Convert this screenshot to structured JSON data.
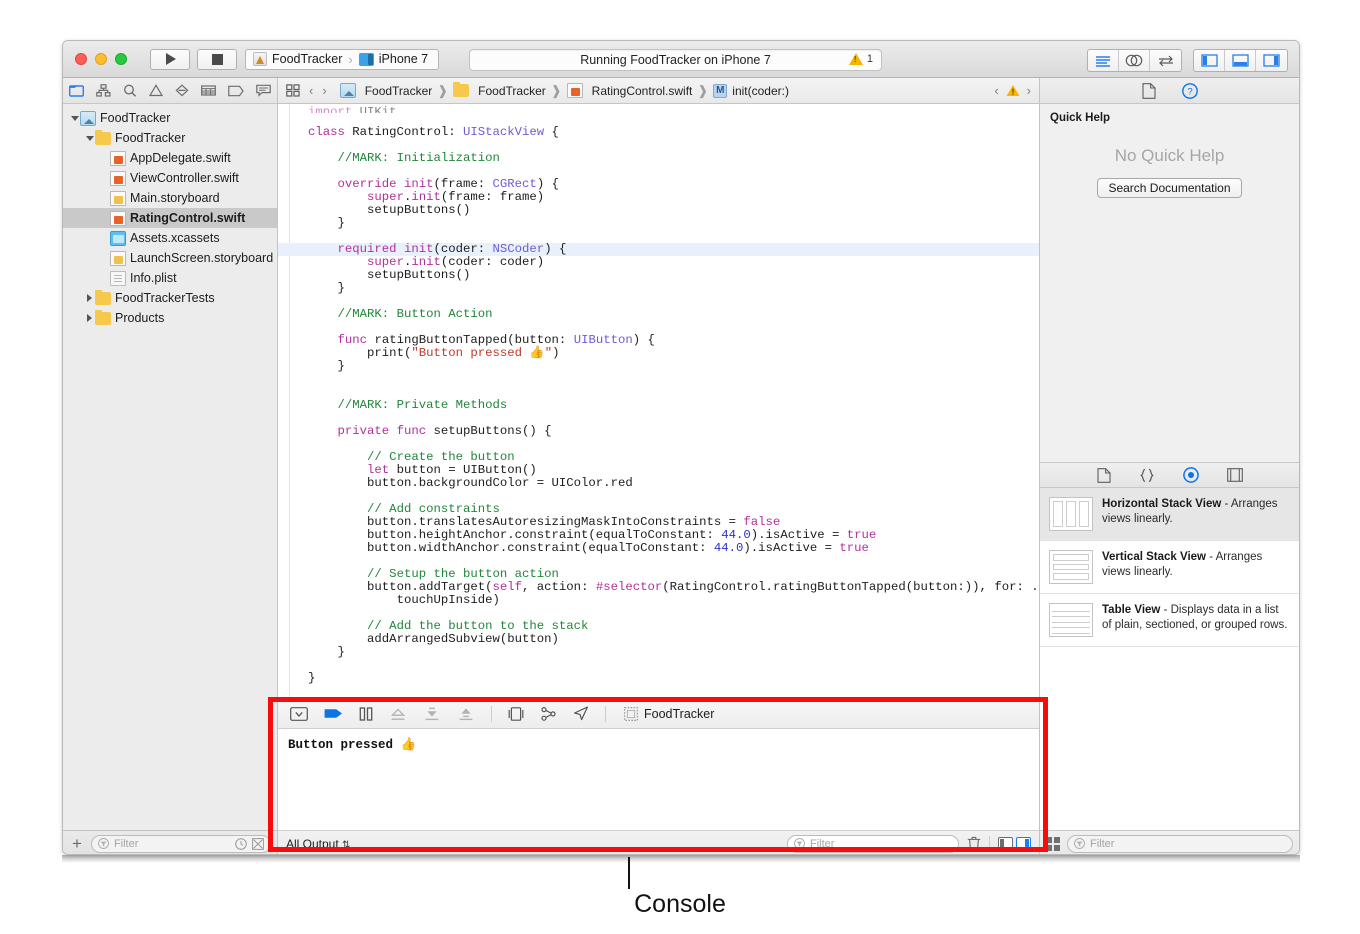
{
  "titlebar": {
    "run_tooltip": "Run",
    "stop_tooltip": "Stop",
    "scheme_project": "FoodTracker",
    "scheme_sep": "›",
    "scheme_device": "iPhone 7",
    "status": "Running FoodTracker on iPhone 7",
    "warning_count": "1"
  },
  "navigator": {
    "icons": [
      "folder-icon",
      "hierarchy-icon",
      "search-icon",
      "warning-icon",
      "issue-icon",
      "test-icon",
      "debug-icon",
      "breakpoint-icon"
    ],
    "tree": [
      {
        "label": "FoodTracker",
        "indent": 0,
        "icon": "project-icon",
        "twisty": "open",
        "selected": false
      },
      {
        "label": "FoodTracker",
        "indent": 1,
        "icon": "folder-icon",
        "twisty": "open",
        "selected": false
      },
      {
        "label": "AppDelegate.swift",
        "indent": 2,
        "icon": "swift-icon",
        "twisty": "none",
        "selected": false
      },
      {
        "label": "ViewController.swift",
        "indent": 2,
        "icon": "swift-icon",
        "twisty": "none",
        "selected": false
      },
      {
        "label": "Main.storyboard",
        "indent": 2,
        "icon": "storyboard-icon",
        "twisty": "none",
        "selected": false
      },
      {
        "label": "RatingControl.swift",
        "indent": 2,
        "icon": "swift-icon",
        "twisty": "none",
        "selected": true
      },
      {
        "label": "Assets.xcassets",
        "indent": 2,
        "icon": "assets-icon",
        "twisty": "none",
        "selected": false
      },
      {
        "label": "LaunchScreen.storyboard",
        "indent": 2,
        "icon": "storyboard-icon",
        "twisty": "none",
        "selected": false
      },
      {
        "label": "Info.plist",
        "indent": 2,
        "icon": "plist-icon",
        "twisty": "none",
        "selected": false
      },
      {
        "label": "FoodTrackerTests",
        "indent": 1,
        "icon": "folder-icon",
        "twisty": "closed",
        "selected": false
      },
      {
        "label": "Products",
        "indent": 1,
        "icon": "folder-icon",
        "twisty": "closed",
        "selected": false
      }
    ],
    "filter_placeholder": "Filter",
    "add_label": "+"
  },
  "jumpbar": {
    "back": "‹",
    "forward": "›",
    "crumbs": [
      "FoodTracker",
      "FoodTracker",
      "RatingControl.swift",
      "init(coder:)"
    ],
    "crumb_icons": [
      "project-icon",
      "folder-icon",
      "swift-icon",
      "method-icon"
    ],
    "method_badge": "M",
    "issue_prev": "‹",
    "issue_next": "›"
  },
  "code": {
    "lines": [
      {
        "indent": 0,
        "tokens": [
          {
            "t": "import ",
            "c": "k"
          },
          {
            "t": "UIKit",
            "c": "d"
          }
        ],
        "clipped": true
      },
      {
        "indent": 0,
        "tokens": []
      },
      {
        "indent": 0,
        "tokens": [
          {
            "t": "class ",
            "c": "k"
          },
          {
            "t": "RatingControl",
            "c": "d"
          },
          {
            "t": ": ",
            "c": "d"
          },
          {
            "t": "UIStackView",
            "c": "t"
          },
          {
            "t": " {",
            "c": "d"
          }
        ]
      },
      {
        "indent": 0,
        "tokens": []
      },
      {
        "indent": 1,
        "tokens": [
          {
            "t": "//MARK: Initialization",
            "c": "c"
          }
        ]
      },
      {
        "indent": 0,
        "tokens": []
      },
      {
        "indent": 1,
        "tokens": [
          {
            "t": "override ",
            "c": "k"
          },
          {
            "t": "init",
            "c": "k"
          },
          {
            "t": "(frame: ",
            "c": "d"
          },
          {
            "t": "CGRect",
            "c": "t"
          },
          {
            "t": ") {",
            "c": "d"
          }
        ]
      },
      {
        "indent": 2,
        "tokens": [
          {
            "t": "super",
            "c": "p"
          },
          {
            "t": ".",
            "c": "d"
          },
          {
            "t": "init",
            "c": "k"
          },
          {
            "t": "(frame: frame)",
            "c": "d"
          }
        ]
      },
      {
        "indent": 2,
        "tokens": [
          {
            "t": "setupButtons()",
            "c": "d"
          }
        ]
      },
      {
        "indent": 1,
        "tokens": [
          {
            "t": "}",
            "c": "d"
          }
        ]
      },
      {
        "indent": 0,
        "tokens": []
      },
      {
        "indent": 1,
        "highlight": true,
        "tokens": [
          {
            "t": "required ",
            "c": "k"
          },
          {
            "t": "init",
            "c": "k"
          },
          {
            "t": "(coder: ",
            "c": "d"
          },
          {
            "t": "NSCoder",
            "c": "t"
          },
          {
            "t": ") {",
            "c": "d"
          }
        ]
      },
      {
        "indent": 2,
        "tokens": [
          {
            "t": "super",
            "c": "p"
          },
          {
            "t": ".",
            "c": "d"
          },
          {
            "t": "init",
            "c": "k"
          },
          {
            "t": "(coder: coder)",
            "c": "d"
          }
        ]
      },
      {
        "indent": 2,
        "tokens": [
          {
            "t": "setupButtons()",
            "c": "d"
          }
        ]
      },
      {
        "indent": 1,
        "tokens": [
          {
            "t": "}",
            "c": "d"
          }
        ]
      },
      {
        "indent": 0,
        "tokens": []
      },
      {
        "indent": 1,
        "tokens": [
          {
            "t": "//MARK: Button Action",
            "c": "c"
          }
        ]
      },
      {
        "indent": 0,
        "tokens": []
      },
      {
        "indent": 1,
        "tokens": [
          {
            "t": "func ",
            "c": "k"
          },
          {
            "t": "ratingButtonTapped",
            "c": "d"
          },
          {
            "t": "(button: ",
            "c": "d"
          },
          {
            "t": "UIButton",
            "c": "t"
          },
          {
            "t": ") {",
            "c": "d"
          }
        ]
      },
      {
        "indent": 2,
        "tokens": [
          {
            "t": "print(",
            "c": "d"
          },
          {
            "t": "\"Button pressed 👍\"",
            "c": "s"
          },
          {
            "t": ")",
            "c": "d"
          }
        ]
      },
      {
        "indent": 1,
        "tokens": [
          {
            "t": "}",
            "c": "d"
          }
        ]
      },
      {
        "indent": 0,
        "tokens": []
      },
      {
        "indent": 0,
        "tokens": []
      },
      {
        "indent": 1,
        "tokens": [
          {
            "t": "//MARK: Private Methods",
            "c": "c"
          }
        ]
      },
      {
        "indent": 0,
        "tokens": []
      },
      {
        "indent": 1,
        "tokens": [
          {
            "t": "private func ",
            "c": "k"
          },
          {
            "t": "setupButtons() {",
            "c": "d"
          }
        ]
      },
      {
        "indent": 0,
        "tokens": []
      },
      {
        "indent": 2,
        "tokens": [
          {
            "t": "// Create the button",
            "c": "c"
          }
        ]
      },
      {
        "indent": 2,
        "tokens": [
          {
            "t": "let ",
            "c": "k"
          },
          {
            "t": "button = UIButton()",
            "c": "d"
          }
        ]
      },
      {
        "indent": 2,
        "tokens": [
          {
            "t": "button.backgroundColor = UIColor.red",
            "c": "d"
          }
        ]
      },
      {
        "indent": 0,
        "tokens": []
      },
      {
        "indent": 2,
        "tokens": [
          {
            "t": "// Add constraints",
            "c": "c"
          }
        ]
      },
      {
        "indent": 2,
        "tokens": [
          {
            "t": "button.translatesAutoresizingMaskIntoConstraints = ",
            "c": "d"
          },
          {
            "t": "false",
            "c": "p"
          }
        ]
      },
      {
        "indent": 2,
        "tokens": [
          {
            "t": "button.heightAnchor.constraint(equalToConstant: ",
            "c": "d"
          },
          {
            "t": "44.0",
            "c": "n"
          },
          {
            "t": ").isActive = ",
            "c": "d"
          },
          {
            "t": "true",
            "c": "p"
          }
        ]
      },
      {
        "indent": 2,
        "tokens": [
          {
            "t": "button.widthAnchor.constraint(equalToConstant: ",
            "c": "d"
          },
          {
            "t": "44.0",
            "c": "n"
          },
          {
            "t": ").isActive = ",
            "c": "d"
          },
          {
            "t": "true",
            "c": "p"
          }
        ]
      },
      {
        "indent": 0,
        "tokens": []
      },
      {
        "indent": 2,
        "tokens": [
          {
            "t": "// Setup the button action",
            "c": "c"
          }
        ]
      },
      {
        "indent": 2,
        "tokens": [
          {
            "t": "button.addTarget(",
            "c": "d"
          },
          {
            "t": "self",
            "c": "p"
          },
          {
            "t": ", action: ",
            "c": "d"
          },
          {
            "t": "#selector",
            "c": "p"
          },
          {
            "t": "(RatingControl.ratingButtonTapped(button:)), for: .",
            "c": "d"
          }
        ]
      },
      {
        "indent": 3,
        "tokens": [
          {
            "t": "touchUpInside)",
            "c": "d"
          }
        ]
      },
      {
        "indent": 0,
        "tokens": []
      },
      {
        "indent": 2,
        "tokens": [
          {
            "t": "// Add the button to the stack",
            "c": "c"
          }
        ]
      },
      {
        "indent": 2,
        "tokens": [
          {
            "t": "addArrangedSubview(button)",
            "c": "d"
          }
        ]
      },
      {
        "indent": 1,
        "tokens": [
          {
            "t": "}",
            "c": "d"
          }
        ]
      },
      {
        "indent": 0,
        "tokens": []
      },
      {
        "indent": 0,
        "tokens": [
          {
            "t": "}",
            "c": "d"
          }
        ]
      }
    ]
  },
  "debug": {
    "toolbar_icons": [
      "hide-console-icon",
      "continue-icon",
      "pause-icon",
      "step-over-icon",
      "step-into-icon",
      "step-out-icon",
      "view-debugging-icon",
      "view-hierarchy-icon",
      "location-simulate-icon"
    ],
    "process_icon": "process-icon",
    "process_name": "FoodTracker",
    "console_text": "Button pressed 👍",
    "output_scope": "All Output",
    "output_scope_arrow": "⇅",
    "filter_placeholder": "Filter",
    "trash_icon": "trash-icon"
  },
  "utilities": {
    "tabs": [
      "file-inspector-icon",
      "quick-help-icon"
    ],
    "quick_help_title": "Quick Help",
    "quick_help_empty": "No Quick Help",
    "search_docs_label": "Search Documentation",
    "library_tabs": [
      "file-template-library-icon",
      "code-snippet-library-icon",
      "object-library-icon",
      "media-library-icon"
    ],
    "library_items": [
      {
        "name": "Horizontal Stack View",
        "desc": " - Arranges views linearly.",
        "thumb": "h",
        "selected": true
      },
      {
        "name": "Vertical Stack View",
        "desc": " - Arranges views linearly.",
        "thumb": "v",
        "selected": false
      },
      {
        "name": "Table View",
        "desc": " - Displays data in a list of plain, sectioned, or grouped rows.",
        "thumb": "tv",
        "selected": false
      }
    ],
    "filter_placeholder": "Filter"
  },
  "caption": {
    "label": "Console"
  },
  "colors": {
    "accent_blue": "#1a7ef0",
    "highlight_red": "#f60c0c",
    "warning_yellow": "#f7b500",
    "selected_row": "#c9c9c9"
  }
}
